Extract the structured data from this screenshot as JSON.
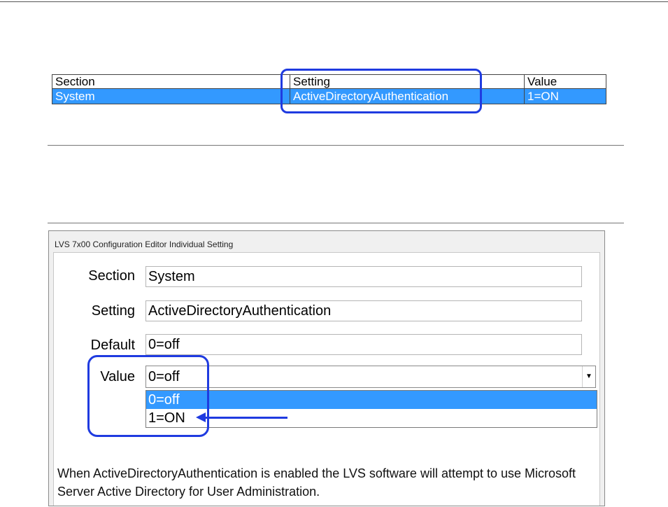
{
  "table": {
    "headers": [
      "Section",
      "Setting",
      "Value"
    ],
    "row": [
      "System",
      "ActiveDirectoryAuthentication",
      "1=ON"
    ]
  },
  "dialog": {
    "title": "LVS 7x00 Configuration Editor Individual Setting",
    "section_label": "Section",
    "section_value": "System",
    "setting_label": "Setting",
    "setting_value": "ActiveDirectoryAuthentication",
    "default_label": "Default",
    "default_value": "0=off",
    "value_label": "Value",
    "value_selected": "0=off",
    "value_options": [
      "0=off",
      "1=ON"
    ],
    "note": "When ActiveDirectoryAuthentication is enabled the LVS software will attempt to use Microsoft Server Active Directory for User Administration."
  },
  "colors": {
    "highlight": "#3399ff",
    "annotation": "#1f3be0"
  }
}
